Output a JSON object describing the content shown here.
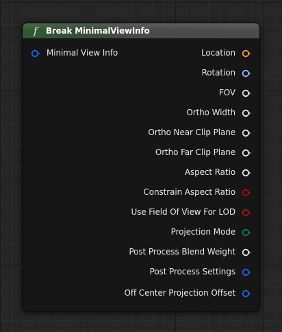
{
  "node": {
    "title": "Break MinimalViewInfo",
    "function_icon": "f",
    "input_pins": [
      {
        "label": "Minimal View Info",
        "color": "#1e64e6",
        "icon": "struct-pin-icon"
      }
    ],
    "output_pins": [
      {
        "label": "Location",
        "color": "#f2a51a",
        "icon": "struct-pin-icon"
      },
      {
        "label": "Rotation",
        "color": "#9db4ff",
        "icon": "struct-pin-icon"
      },
      {
        "label": "FOV",
        "color": "#e8e8e8",
        "icon": "float-pin-icon"
      },
      {
        "label": "Ortho Width",
        "color": "#e8e8e8",
        "icon": "float-pin-icon"
      },
      {
        "label": "Ortho Near Clip Plane",
        "color": "#e8e8e8",
        "icon": "float-pin-icon"
      },
      {
        "label": "Ortho Far Clip Plane",
        "color": "#e8e8e8",
        "icon": "float-pin-icon"
      },
      {
        "label": "Aspect Ratio",
        "color": "#e8e8e8",
        "icon": "float-pin-icon"
      },
      {
        "label": "Constrain Aspect Ratio",
        "color": "#a81010",
        "icon": "bool-pin-icon"
      },
      {
        "label": "Use Field Of View For LOD",
        "color": "#a81010",
        "icon": "bool-pin-icon"
      },
      {
        "label": "Projection Mode",
        "color": "#0d7a5e",
        "icon": "enum-pin-icon"
      },
      {
        "label": "Post Process Blend Weight",
        "color": "#e8e8e8",
        "icon": "float-pin-icon"
      },
      {
        "label": "Post Process Settings",
        "color": "#1e64e6",
        "icon": "struct-pin-icon"
      },
      {
        "label": "Off Center Projection Offset",
        "color": "#1e64e6",
        "icon": "struct-pin-icon"
      }
    ]
  }
}
